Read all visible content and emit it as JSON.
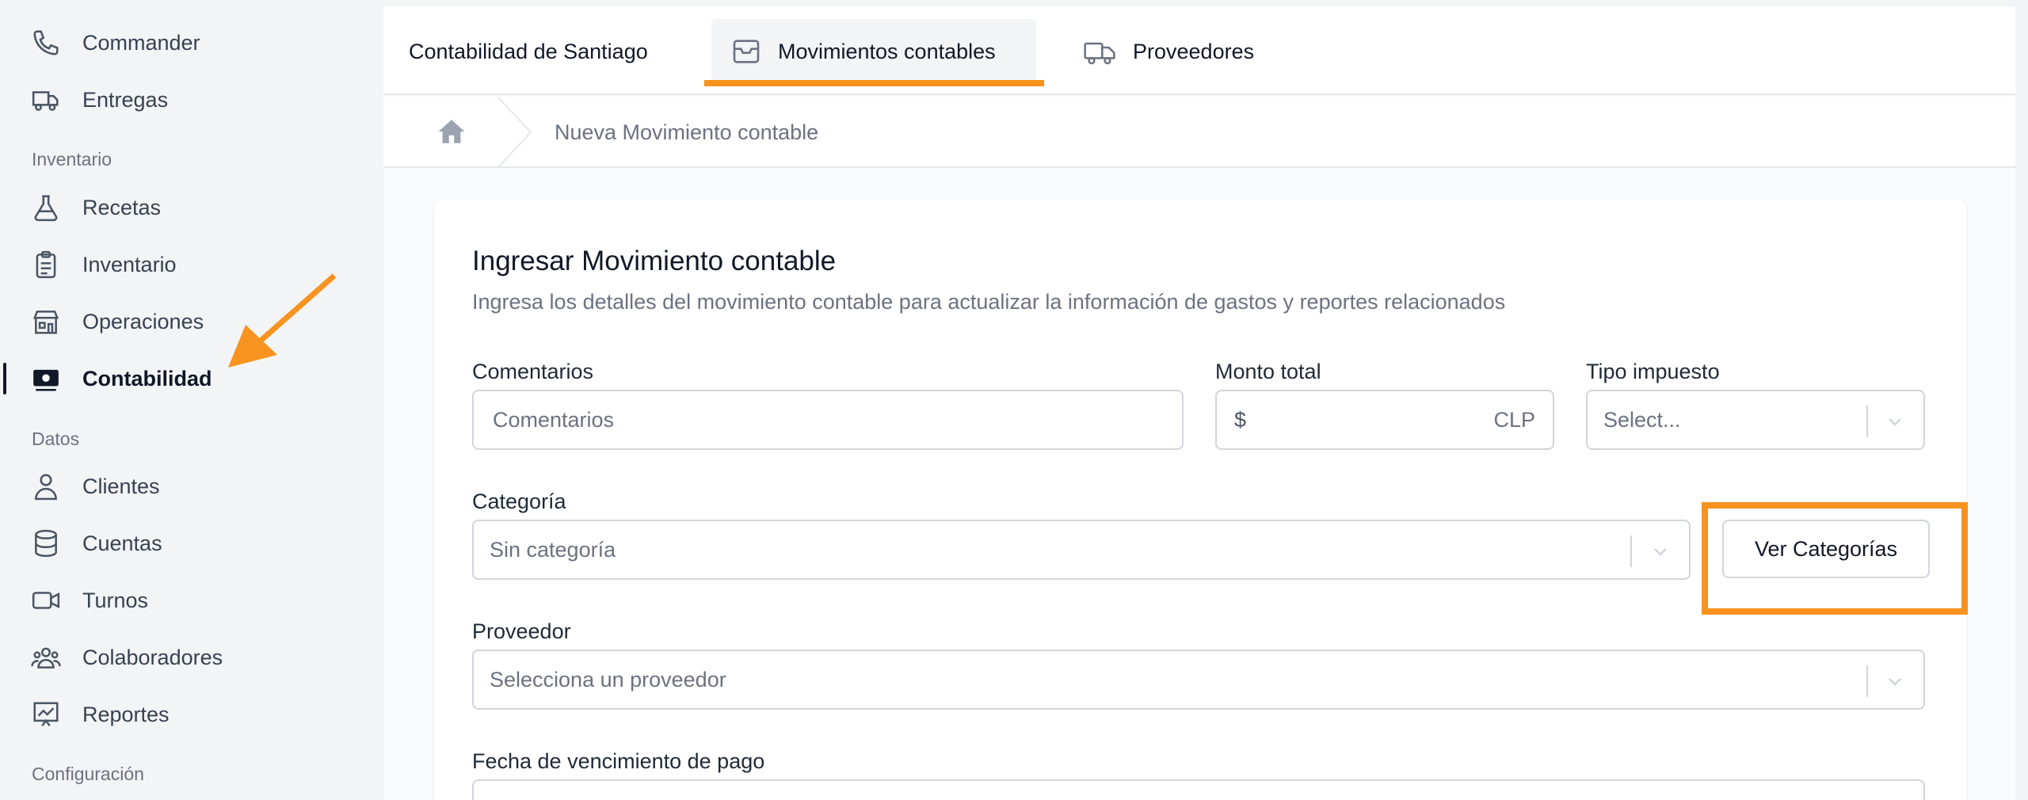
{
  "sidebar": {
    "items_top": [
      {
        "label": "Commander",
        "icon": "phone-icon"
      },
      {
        "label": "Entregas",
        "icon": "truck-icon"
      }
    ],
    "section_inventario": "Inventario",
    "items_inventario": [
      {
        "label": "Recetas",
        "icon": "flask-icon"
      },
      {
        "label": "Inventario",
        "icon": "clipboard-icon"
      },
      {
        "label": "Operaciones",
        "icon": "store-icon"
      },
      {
        "label": "Contabilidad",
        "icon": "cash-icon",
        "active": true
      }
    ],
    "section_datos": "Datos",
    "items_datos": [
      {
        "label": "Clientes",
        "icon": "user-icon"
      },
      {
        "label": "Cuentas",
        "icon": "database-icon"
      },
      {
        "label": "Turnos",
        "icon": "video-icon"
      },
      {
        "label": "Colaboradores",
        "icon": "users-icon"
      },
      {
        "label": "Reportes",
        "icon": "chart-icon"
      }
    ],
    "section_config": "Configuración"
  },
  "tabs": [
    {
      "label": "Contabilidad de Santiago"
    },
    {
      "label": "Movimientos contables",
      "icon": "inbox-icon",
      "active": true
    },
    {
      "label": "Proveedores",
      "icon": "truck-icon"
    }
  ],
  "breadcrumb": {
    "home_icon": "home-icon",
    "current": "Nueva Movimiento contable"
  },
  "form": {
    "title": "Ingresar Movimiento contable",
    "subtitle": "Ingresa los detalles del movimiento contable para actualizar la información de gastos y reportes relacionados",
    "comentarios": {
      "label": "Comentarios",
      "placeholder": "Comentarios"
    },
    "monto": {
      "label": "Monto total",
      "prefix": "$",
      "suffix": "CLP"
    },
    "impuesto": {
      "label": "Tipo impuesto",
      "placeholder": "Select..."
    },
    "categoria": {
      "label": "Categoría",
      "value": "Sin categoría"
    },
    "ver_categorias": "Ver Categorías",
    "proveedor": {
      "label": "Proveedor",
      "placeholder": "Selecciona un proveedor"
    },
    "fecha": {
      "label": "Fecha de vencimiento de pago"
    }
  },
  "colors": {
    "accent": "#f7931e",
    "text": "#111827",
    "muted": "#6b7280"
  }
}
